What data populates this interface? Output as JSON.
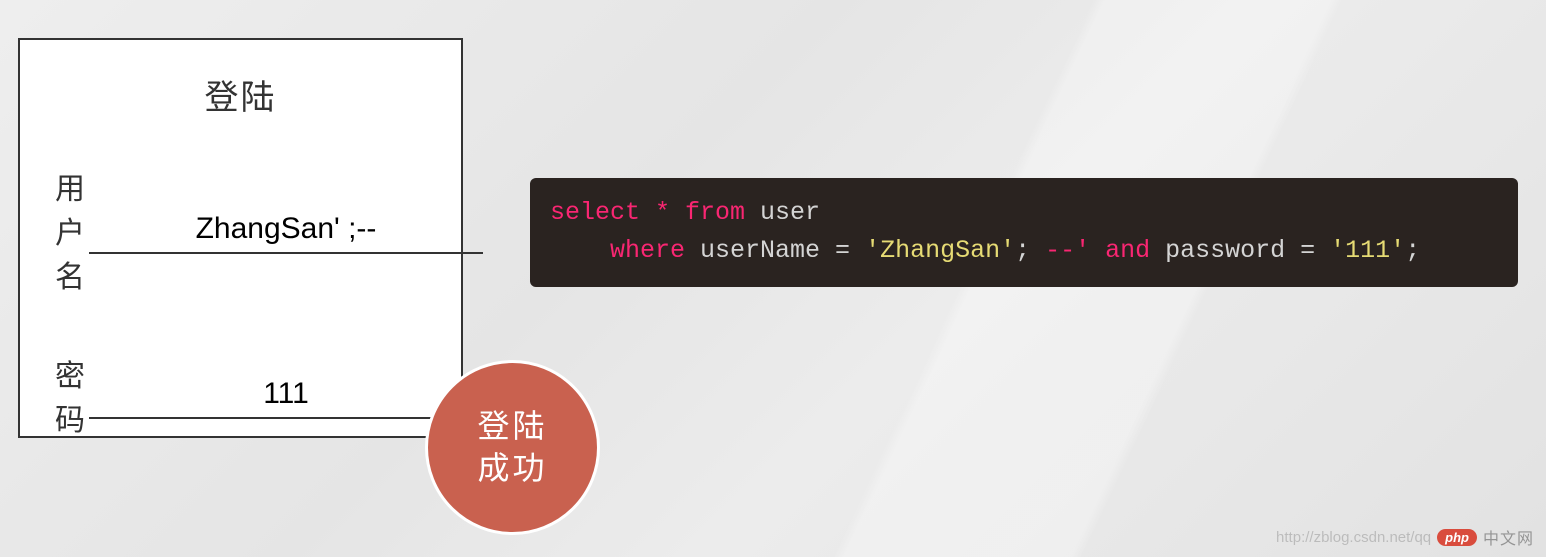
{
  "login": {
    "title": "登陆",
    "username_label": "用户名",
    "username_value": "ZhangSan' ;--",
    "password_label": "密码",
    "password_value": "111"
  },
  "success": {
    "text": "登陆\n成功"
  },
  "code": {
    "line1_select": "select",
    "line1_star": " * ",
    "line1_from": "from",
    "line1_user": " user",
    "line2_indent": "    ",
    "line2_where": "where",
    "line2_col": " userName = ",
    "line2_str": "'ZhangSan'",
    "line2_semi": "; ",
    "line2_cmt": "--'",
    "line2_and": " and",
    "line2_pwcol": " password = ",
    "line2_pwstr": "'111'",
    "line2_end": ";"
  },
  "watermark": {
    "url": "http://zblog.csdn.net/qq",
    "badge": "php",
    "text": "中文网"
  }
}
